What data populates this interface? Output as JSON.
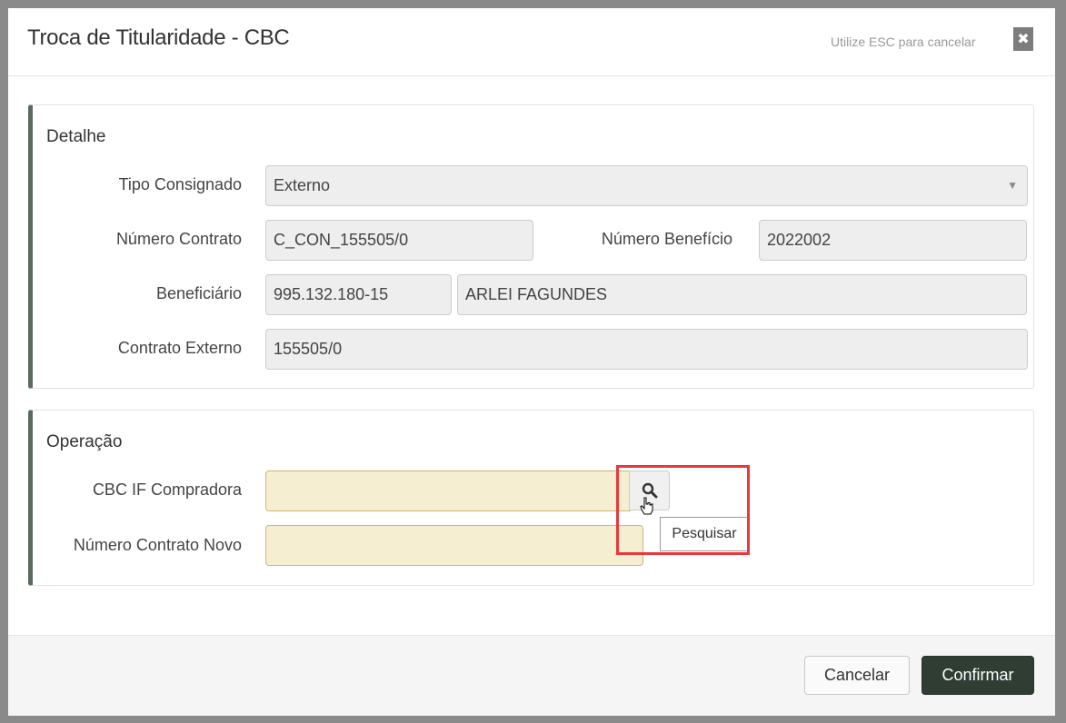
{
  "modal": {
    "title": "Troca de Titularidade - CBC",
    "esc_hint": "Utilize ESC para cancelar",
    "close_glyph": "✖"
  },
  "detalhe": {
    "title": "Detalhe",
    "tipo_consignado": {
      "label": "Tipo Consignado",
      "value": "Externo"
    },
    "numero_contrato": {
      "label": "Número Contrato",
      "value": "C_CON_155505/0"
    },
    "numero_beneficio": {
      "label": "Número Benefício",
      "value": "2022002"
    },
    "beneficiario": {
      "label": "Beneficiário",
      "cpf": "995.132.180-15",
      "name": "ARLEI FAGUNDES"
    },
    "contrato_externo": {
      "label": "Contrato Externo",
      "value": "155505/0"
    }
  },
  "operacao": {
    "title": "Operação",
    "cbc_if_compradora": {
      "label": "CBC IF Compradora",
      "value": ""
    },
    "numero_contrato_novo": {
      "label": "Número Contrato Novo",
      "value": ""
    },
    "search_tooltip": "Pesquisar"
  },
  "footer": {
    "cancel_label": "Cancelar",
    "confirm_label": "Confirmar"
  },
  "icons": {
    "search": "search-icon",
    "close": "close-icon",
    "dropdown": "chevron-down-icon",
    "cursor": "hand-pointer-icon"
  },
  "colors": {
    "accent_border": "#5a6b5c",
    "confirm_button": "#2f3d32",
    "input_yellow": "#f5eed0",
    "highlight_red": "#e8383c"
  }
}
